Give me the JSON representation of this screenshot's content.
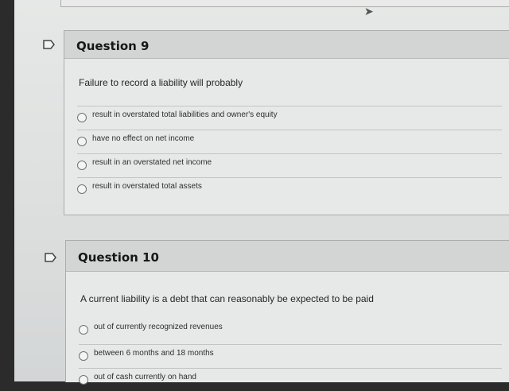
{
  "questions": [
    {
      "number": "9",
      "title": "Question 9",
      "text": "Failure to record a liability will probably",
      "options": [
        "result in overstated total liabilities and owner's equity",
        "have no effect on net income",
        "result in an overstated net income",
        "result in overstated total assets"
      ]
    },
    {
      "number": "10",
      "title": "Question 10",
      "text": "A current liability is a debt that can reasonably be expected to be paid",
      "options": [
        "out of currently recognized revenues",
        "between 6 months and 18 months",
        "out of cash currently on hand"
      ]
    }
  ],
  "icons": {
    "cursor": "cursor-arrow-icon",
    "question_marker": "flag-marker-icon"
  },
  "colors": {
    "header_bg": "#d2d5d4",
    "panel_bg": "#e7e9e8",
    "border": "#a9adac"
  }
}
